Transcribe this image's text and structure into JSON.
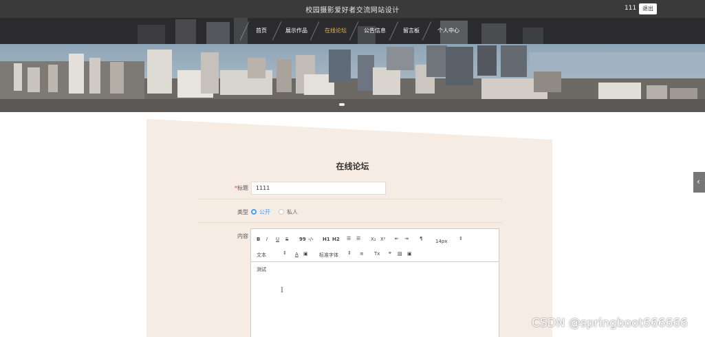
{
  "header": {
    "site_title": "校园摄影爱好者交流网站设计",
    "user_name": "111",
    "logout_label": "退出"
  },
  "nav": {
    "items": [
      {
        "label": "首页"
      },
      {
        "label": "展示作品"
      },
      {
        "label": "在线论坛"
      },
      {
        "label": "公告信息"
      },
      {
        "label": "留言板"
      },
      {
        "label": "个人中心"
      }
    ],
    "active_index": 2
  },
  "form": {
    "title": "在线论坛",
    "title_field": {
      "label": "标题",
      "required_mark": "*",
      "value": "1111"
    },
    "type_field": {
      "label": "类型",
      "options": [
        {
          "label": "公开",
          "selected": true
        },
        {
          "label": "私人",
          "selected": false
        }
      ]
    },
    "content_field": {
      "label": "内容",
      "toolbar": {
        "bold": "B",
        "italic": "I",
        "underline": "U",
        "strike": "S",
        "quote": "99",
        "code": "‹/›",
        "h1": "H1",
        "h2": "H2",
        "ordered": "☰",
        "bullet": "☰",
        "sub": "X₂",
        "sup": "X²",
        "outdent": "⇤",
        "indent": "⇥",
        "direction": "¶",
        "size": "14px",
        "text_style": "文本",
        "font_color": "A",
        "background": "▣",
        "font_family": "标准字体",
        "align": "≡",
        "clean": "Tx",
        "link": "🔗",
        "image": "▨",
        "video": "▣"
      },
      "value": "测试"
    }
  },
  "watermark": "CSDN @springboot666666",
  "colors": {
    "accent": "#409eff",
    "nav_active": "#e9b44c",
    "panel": "#f6ece3"
  }
}
